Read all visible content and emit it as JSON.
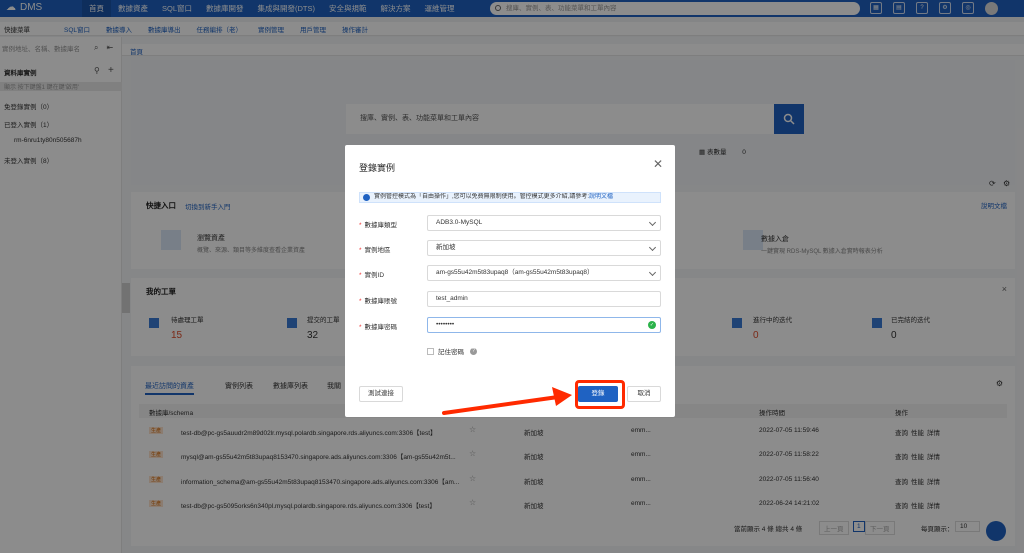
{
  "topbar": {
    "logo": "DMS",
    "nav": [
      "首頁",
      "數據資產",
      "SQL窗口",
      "數據庫開發",
      "集成與開發(DTS)",
      "安全與規範",
      "解決方案",
      "運維管理"
    ],
    "search_placeholder": "搜庫、實例、表、功能菜單和工單內容"
  },
  "subnav": {
    "menu": "快捷菜單",
    "items": [
      "SQL窗口",
      "數據導入",
      "數據庫導出",
      "任務編排（老）",
      "實例管理",
      "用戶管理",
      "操作審計"
    ]
  },
  "sidebar": {
    "search_placeholder": "實例地址、名稱、數據庫名",
    "header": "資料庫實例",
    "tool": "顯示 按下鍵盤1 鍵在鍵'啟用'",
    "items": [
      {
        "label": "免登錄實例（0）"
      },
      {
        "label": "已登入實例（1）"
      },
      {
        "label": "rm-6nru1ty80n505687h"
      },
      {
        "label": "未登入實例（8）"
      }
    ]
  },
  "page_tab": "首頁",
  "hero": {
    "search_placeholder": "搜庫、實例、表、功能菜單和工單內容",
    "table_count_label": "表數量",
    "table_count": "0"
  },
  "quick": {
    "title": "快捷入口",
    "switch_link": "切換到新手入門",
    "doc_link": "說明文檔",
    "asset_title": "瀏覽資產",
    "asset_desc": "概覽、來源、類目等多維度查看企業資產",
    "import_title": "數據入倉",
    "import_desc": "一鍵實現 RDS-MySQL 數據入倉實時報表分析"
  },
  "tickets": {
    "title": "我的工單",
    "items": [
      {
        "label": "待處理工單",
        "value": "15",
        "color": "#e04b2a"
      },
      {
        "label": "提交的工單",
        "value": "32",
        "color": "#333333"
      },
      {
        "label": "進行中的迭代",
        "value": "0",
        "color": "#e04b2a"
      },
      {
        "label": "已完結的迭代",
        "value": "0",
        "color": "#333333"
      }
    ]
  },
  "recent": {
    "tabs": [
      "最近訪問的資產",
      "實例列表",
      "數據庫列表",
      "我關"
    ],
    "columns": [
      "數據庫/schema",
      "",
      "",
      "",
      "操作時間",
      "操作"
    ],
    "rows": [
      {
        "badge": "生產",
        "name": "test-db@pc-gs5auudr2m89d02lr.mysql.polardb.singapore.rds.aliyuncs.com:3306【test】",
        "region": "新加坡",
        "user": "emm...",
        "time": "2022-07-05 11:59:46",
        "ops": [
          "查詢",
          "性能",
          "詳情"
        ]
      },
      {
        "badge": "生產",
        "name": "mysql@am-gs55u42m5t83upaq8153470.singapore.ads.aliyuncs.com:3306【am-gs55u42m5t...",
        "region": "新加坡",
        "user": "emm...",
        "time": "2022-07-05 11:58:22",
        "ops": [
          "查詢",
          "性能",
          "詳情"
        ]
      },
      {
        "badge": "生產",
        "name": "information_schema@am-gs55u42m5t83upaq8153470.singapore.ads.aliyuncs.com:3306【am...",
        "region": "新加坡",
        "user": "emm...",
        "time": "2022-07-05 11:56:40",
        "ops": [
          "查詢",
          "性能",
          "詳情"
        ]
      },
      {
        "badge": "生產",
        "name": "test-db@pc-gs5095orks6n340pl.mysql.polardb.singapore.rds.aliyuncs.com:3306【test】",
        "region": "新加坡",
        "user": "emm...",
        "time": "2022-06-24 14:21:02",
        "ops": [
          "查詢",
          "性能",
          "詳情"
        ]
      }
    ],
    "footer": "當前顯示 4 條 總共 4 條",
    "prev": "上一頁",
    "page": "1",
    "next": "下一頁",
    "per_page_label": "每頁顯示：",
    "per_page": "10"
  },
  "modal": {
    "title": "登錄實例",
    "notice": "實例管控模式為「自由操作」,您可以免費無限制使用。管控模式更多介紹,請參考:",
    "notice_link": "說明文檔",
    "fields": [
      {
        "label": "數據庫類型",
        "value": "ADB3.0-MySQL",
        "type": "select"
      },
      {
        "label": "實例地區",
        "value": "新加坡",
        "type": "select"
      },
      {
        "label": "實例ID",
        "value": "am-gs55u42m5t83upaq8（am-gs55u42m5t83upaq8）",
        "type": "select"
      },
      {
        "label": "數據庫賬號",
        "value": "test_admin",
        "type": "input"
      },
      {
        "label": "數據庫密碼",
        "value": "••••••••",
        "type": "password"
      }
    ],
    "remember": "記住密碼",
    "test_btn": "測試連接",
    "login_btn": "登錄",
    "cancel_btn": "取消"
  },
  "colors": {
    "brand": "#1f62c2",
    "highlight": "#ff2a00"
  }
}
